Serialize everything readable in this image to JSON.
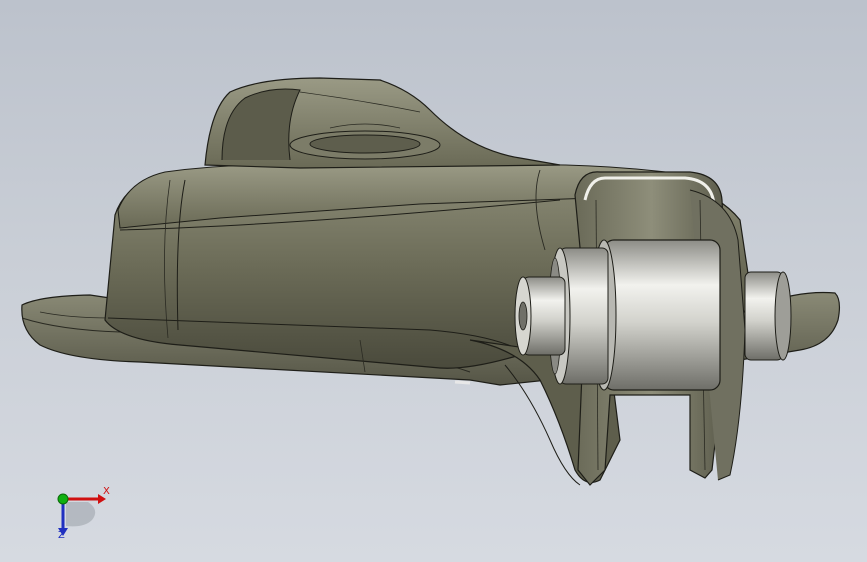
{
  "viewport": {
    "background_top": "#bcc2cc",
    "background_bottom": "#d6dae1"
  },
  "model": {
    "body_color": "#6f6f5c",
    "edge_color": "#1e1e18",
    "metal_color": "#d8d8d2"
  },
  "triad": {
    "x_label": "X",
    "z_label": "Z",
    "x_color": "#d01010",
    "y_color": "#10b010",
    "z_color": "#2030c0"
  }
}
